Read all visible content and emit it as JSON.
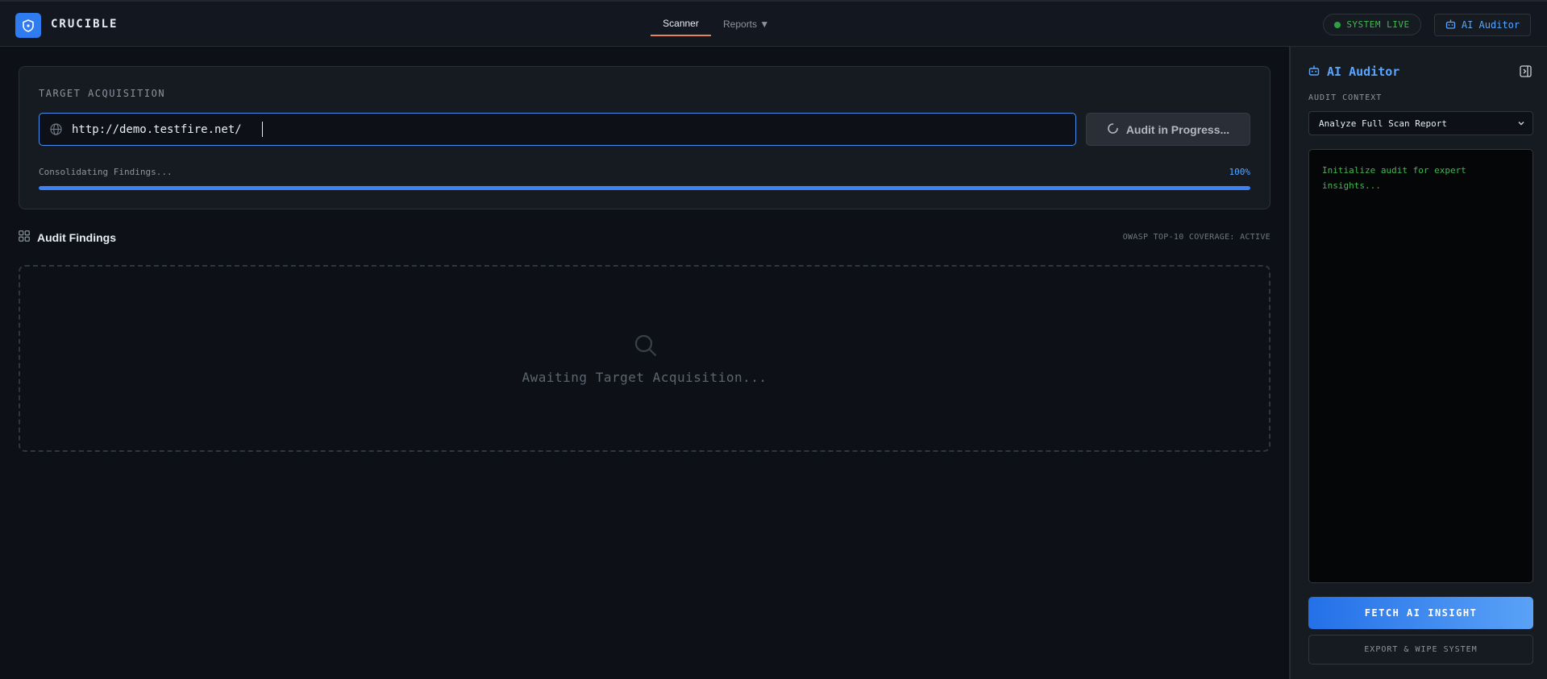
{
  "app": {
    "brand": "CRUCIBLE",
    "logo_icon": "shield-icon"
  },
  "nav": {
    "tabs": [
      {
        "label": "Scanner",
        "active": true
      },
      {
        "label": "Reports ▼",
        "active": false
      }
    ]
  },
  "header": {
    "status_label": "SYSTEM LIVE",
    "status_color": "#3fb950",
    "ai_button_label": "AI Auditor"
  },
  "target": {
    "title": "TARGET ACQUISITION",
    "url_value": "http://demo.testfire.net/",
    "audit_button_label": "Audit in Progress...",
    "progress_label": "Consolidating Findings...",
    "progress_percent_label": "100%",
    "progress_fraction": 1.0
  },
  "findings": {
    "title": "Audit Findings",
    "coverage_label": "OWASP TOP-10 COVERAGE: ACTIVE",
    "empty_message": "Awaiting Target Acquisition..."
  },
  "sidebar": {
    "title": "AI Auditor",
    "context_label": "AUDIT CONTEXT",
    "context_selected": "Analyze Full Scan Report",
    "terminal_text": "Initialize audit for expert insights...",
    "fetch_button_label": "FETCH AI INSIGHT",
    "wipe_button_label": "EXPORT & WIPE SYSTEM"
  },
  "colors": {
    "accent": "#2f7bf0",
    "tab_underline": "#e8845c",
    "terminal_text": "#3fb950"
  }
}
